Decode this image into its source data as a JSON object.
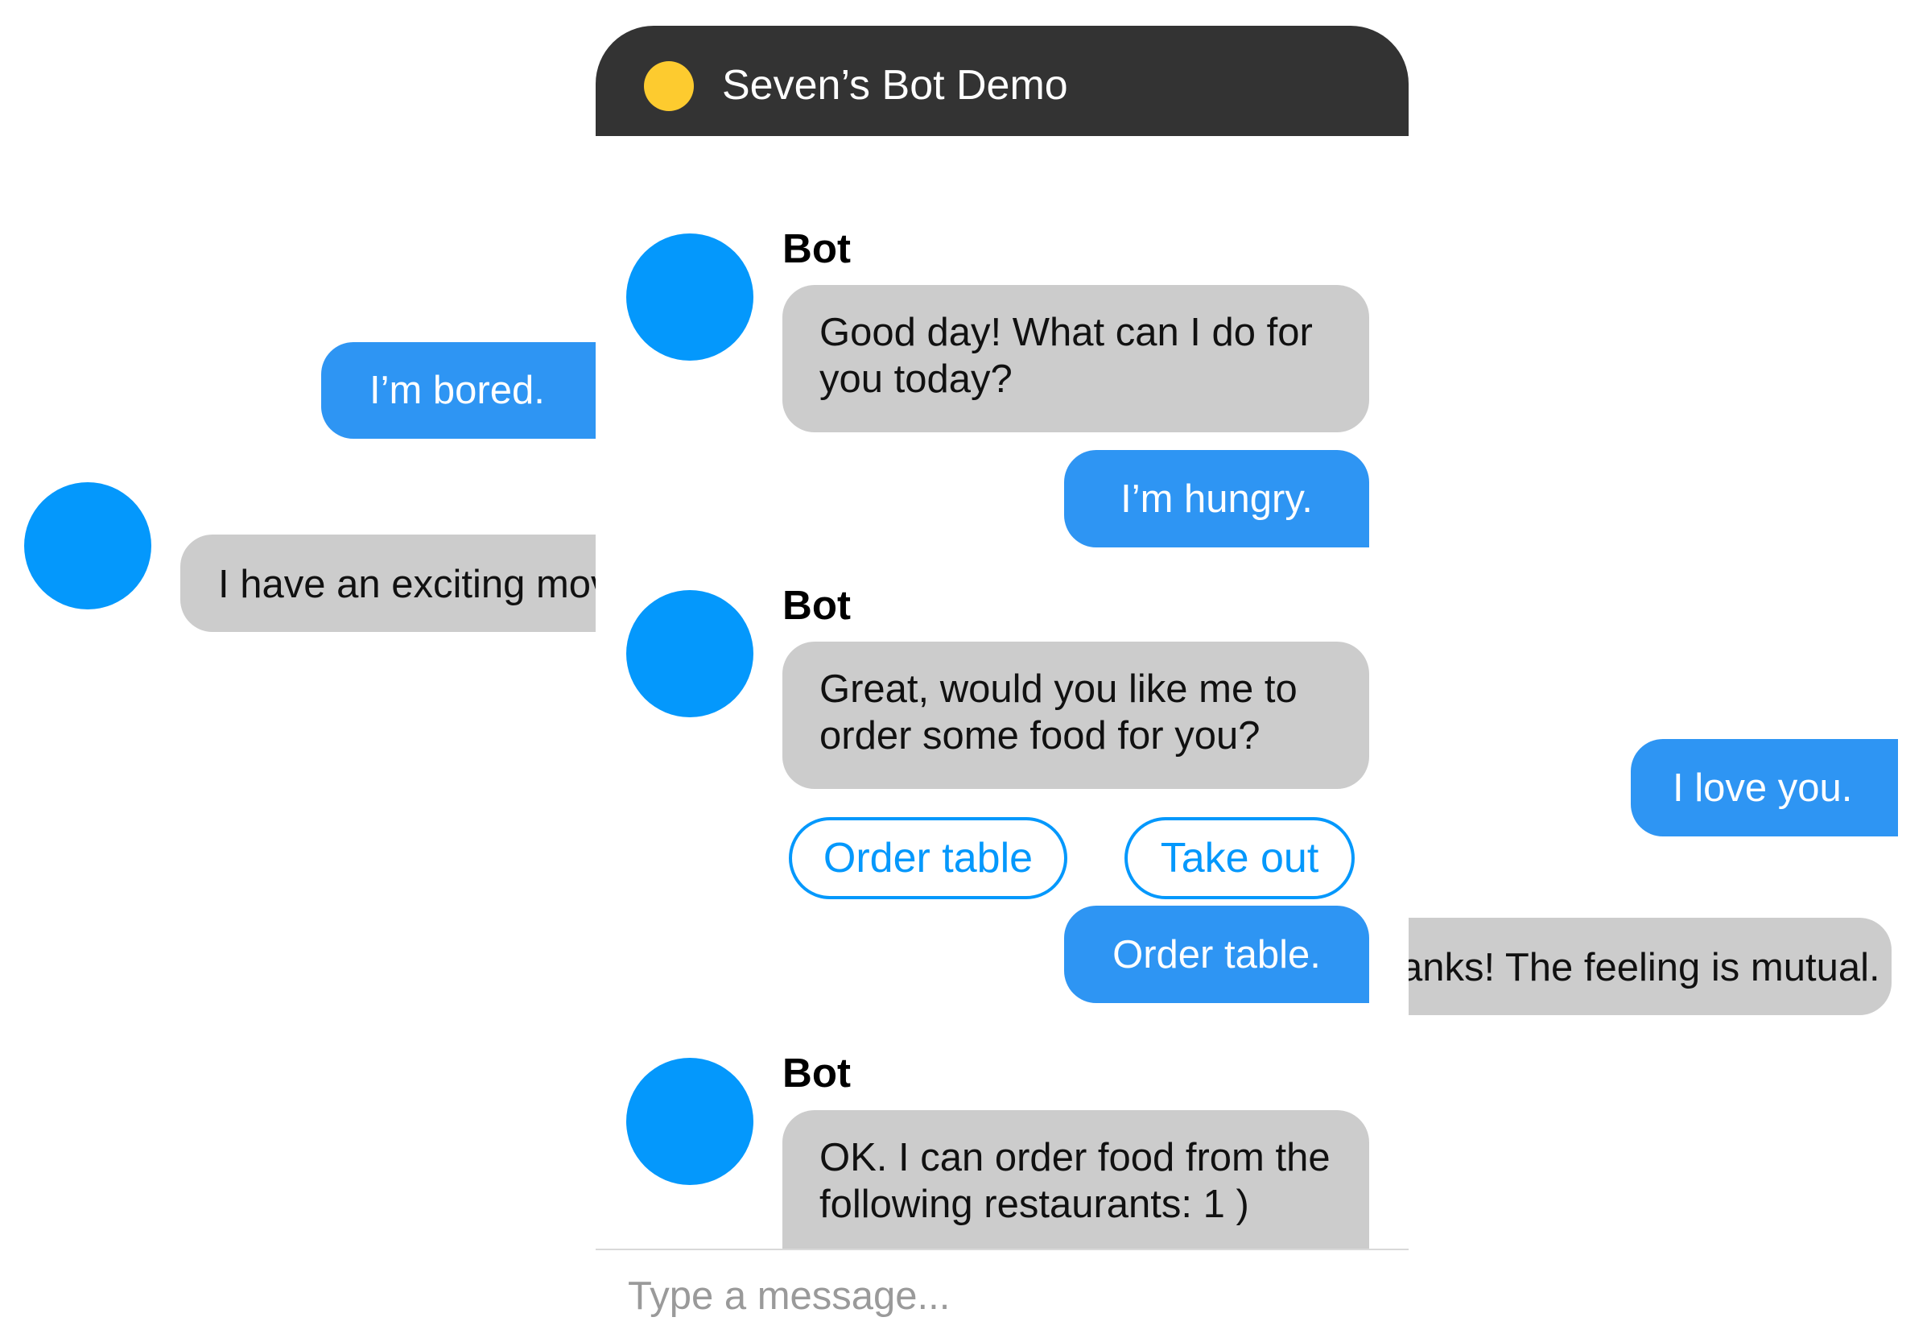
{
  "background": {
    "left_user_message": "I’m bored.",
    "left_bot_message": "I have an exciting mov",
    "right_user_message": "I love you.",
    "right_bot_message": "anks! The feeling is mutual."
  },
  "window": {
    "title": "Seven’s Bot Demo",
    "status_color": "#fdcb2f",
    "messages": [
      {
        "sender": "Bot",
        "text": "Good day!  What can I do for you today?"
      },
      {
        "user_text": "I’m hungry."
      },
      {
        "sender": "Bot",
        "text": "Great, would you like me to order some food for you?"
      },
      {
        "quick_replies": [
          "Order table",
          "Take out"
        ]
      },
      {
        "user_text": "Order table."
      },
      {
        "sender": "Bot",
        "text": "OK. I can order food from the following restaurants: 1 )"
      }
    ],
    "composer": {
      "placeholder": "Type a message..."
    }
  },
  "colors": {
    "header": "#333333",
    "user_bubble": "#2e95f3",
    "bot_bubble": "#cccccc",
    "avatar": "#0498fc",
    "quick_reply": "#0498fc"
  }
}
